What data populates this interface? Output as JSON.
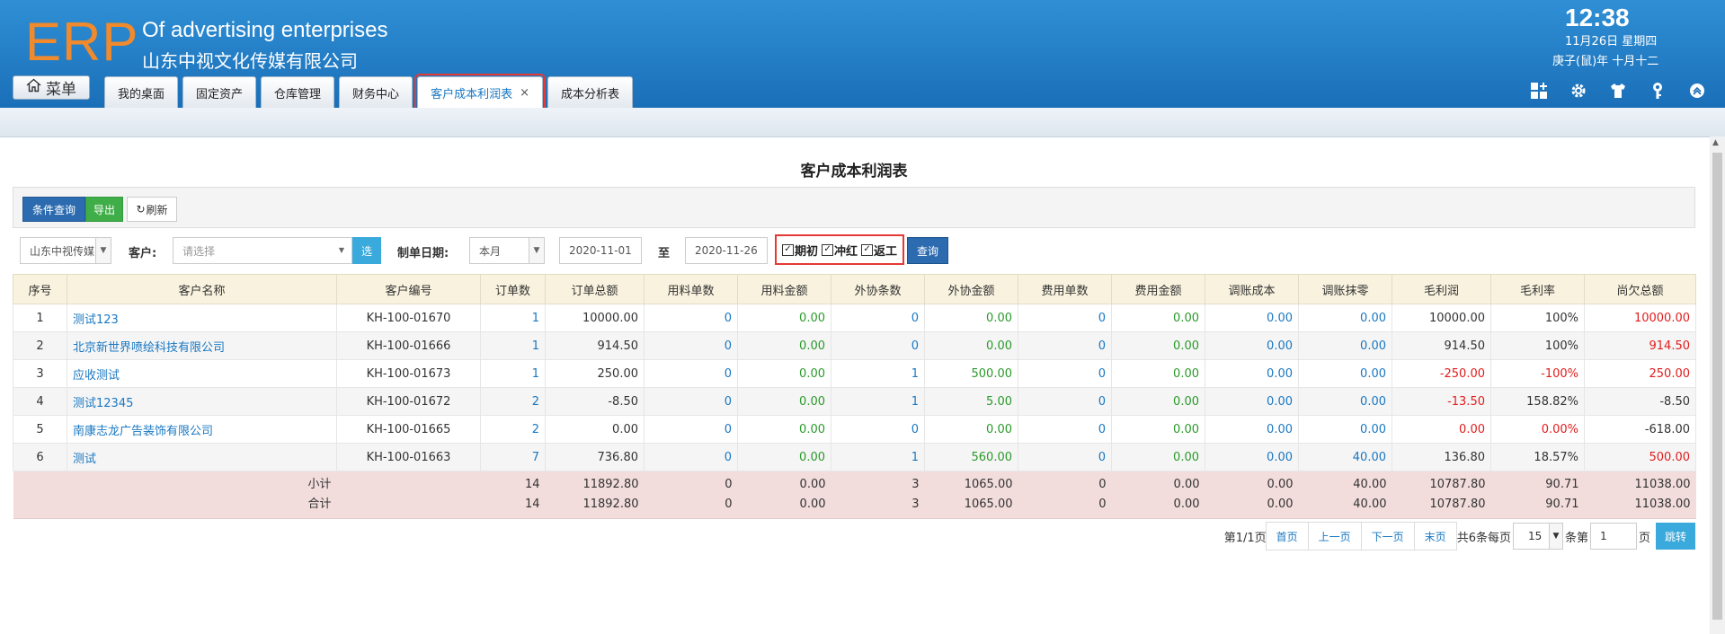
{
  "header": {
    "logo": "ERP",
    "company_en": "Of advertising enterprises",
    "company_cn": "山东中视文化传媒有限公司",
    "time": "12:38",
    "date": "11月26日 星期四",
    "lunar": "庚子(鼠)年 十月十二",
    "menu_label": "菜单"
  },
  "tabs": [
    {
      "label": "我的桌面"
    },
    {
      "label": "固定资产"
    },
    {
      "label": "仓库管理"
    },
    {
      "label": "财务中心"
    },
    {
      "label": "客户成本利润表",
      "close": "×"
    },
    {
      "label": "成本分析表"
    }
  ],
  "top_icons": [
    "grid-add-icon",
    "gear-icon",
    "shirt-icon",
    "key-icon",
    "collapse-up-icon"
  ],
  "page_title": "客户成本利润表",
  "toolbar": {
    "condition_query": "条件查询",
    "export": "导出",
    "refresh": "刷新"
  },
  "filters": {
    "company_value": "山东中视传媒",
    "customer_label": "客户:",
    "customer_placeholder": "请选择",
    "select_btn": "选",
    "date_label": "制单日期:",
    "period_value": "本月",
    "date_from": "2020-11-01",
    "to_label": "至",
    "date_to": "2020-11-26",
    "check_opening": "期初",
    "check_red": "冲红",
    "check_rework": "返工",
    "query_btn": "查询"
  },
  "colors": {
    "header_blue": "#1a6fb8",
    "link_blue": "#1a78c2",
    "green": "#2a9a2a",
    "red": "#e01d1d",
    "highlight": "#e53935"
  },
  "table": {
    "headers": [
      "序号",
      "客户名称",
      "客户编号",
      "订单数",
      "订单总额",
      "用料单数",
      "用料金额",
      "外协条数",
      "外协金额",
      "费用单数",
      "费用金额",
      "调账成本",
      "调账抹零",
      "毛利润",
      "毛利率",
      "尚欠总额"
    ],
    "rows": [
      {
        "no": "1",
        "name": "测试123",
        "code": "KH-100-01670",
        "orders": "1",
        "order_total": "10000.00",
        "mat_count": "0",
        "mat_amount": "0.00",
        "out_count": "0",
        "out_amount": "0.00",
        "fee_count": "0",
        "fee_amount": "0.00",
        "adj_cost": "0.00",
        "adj_round": "0.00",
        "profit": "10000.00",
        "rate": "100%",
        "owed": "10000.00"
      },
      {
        "no": "2",
        "name": "北京新世界喷绘科技有限公司",
        "code": "KH-100-01666",
        "orders": "1",
        "order_total": "914.50",
        "mat_count": "0",
        "mat_amount": "0.00",
        "out_count": "0",
        "out_amount": "0.00",
        "fee_count": "0",
        "fee_amount": "0.00",
        "adj_cost": "0.00",
        "adj_round": "0.00",
        "profit": "914.50",
        "rate": "100%",
        "owed": "914.50"
      },
      {
        "no": "3",
        "name": "应收测试",
        "code": "KH-100-01673",
        "orders": "1",
        "order_total": "250.00",
        "mat_count": "0",
        "mat_amount": "0.00",
        "out_count": "1",
        "out_amount": "500.00",
        "fee_count": "0",
        "fee_amount": "0.00",
        "adj_cost": "0.00",
        "adj_round": "0.00",
        "profit": "-250.00",
        "rate": "-100%",
        "owed": "250.00"
      },
      {
        "no": "4",
        "name": "测试12345",
        "code": "KH-100-01672",
        "orders": "2",
        "order_total": "-8.50",
        "mat_count": "0",
        "mat_amount": "0.00",
        "out_count": "1",
        "out_amount": "5.00",
        "fee_count": "0",
        "fee_amount": "0.00",
        "adj_cost": "0.00",
        "adj_round": "0.00",
        "profit": "-13.50",
        "rate": "158.82%",
        "owed": "-8.50"
      },
      {
        "no": "5",
        "name": "南康志龙广告装饰有限公司",
        "code": "KH-100-01665",
        "orders": "2",
        "order_total": "0.00",
        "mat_count": "0",
        "mat_amount": "0.00",
        "out_count": "0",
        "out_amount": "0.00",
        "fee_count": "0",
        "fee_amount": "0.00",
        "adj_cost": "0.00",
        "adj_round": "0.00",
        "profit": "0.00",
        "rate": "0.00%",
        "owed": "-618.00"
      },
      {
        "no": "6",
        "name": "测试",
        "code": "KH-100-01663",
        "orders": "7",
        "order_total": "736.80",
        "mat_count": "0",
        "mat_amount": "0.00",
        "out_count": "1",
        "out_amount": "560.00",
        "fee_count": "0",
        "fee_amount": "0.00",
        "adj_cost": "0.00",
        "adj_round": "40.00",
        "profit": "136.80",
        "rate": "18.57%",
        "owed": "500.00"
      }
    ],
    "subtotal": {
      "label": "小计",
      "orders": "14",
      "order_total": "11892.80",
      "mat_count": "0",
      "mat_amount": "0.00",
      "out_count": "3",
      "out_amount": "1065.00",
      "fee_count": "0",
      "fee_amount": "0.00",
      "adj_cost": "0.00",
      "adj_round": "40.00",
      "profit": "10787.80",
      "rate": "90.71",
      "owed": "11038.00"
    },
    "total": {
      "label": "合计",
      "orders": "14",
      "order_total": "11892.80",
      "mat_count": "0",
      "mat_amount": "0.00",
      "out_count": "3",
      "out_amount": "1065.00",
      "fee_count": "0",
      "fee_amount": "0.00",
      "adj_cost": "0.00",
      "adj_round": "40.00",
      "profit": "10787.80",
      "rate": "90.71",
      "owed": "11038.00"
    }
  },
  "pager": {
    "page_info": "第1/1页",
    "first": "首页",
    "prev": "上一页",
    "next": "下一页",
    "last": "末页",
    "total_info": "共6条每页",
    "page_size": "15",
    "size_suffix": "条第",
    "page_input": "1",
    "page_suffix": "页",
    "go": "跳转"
  }
}
